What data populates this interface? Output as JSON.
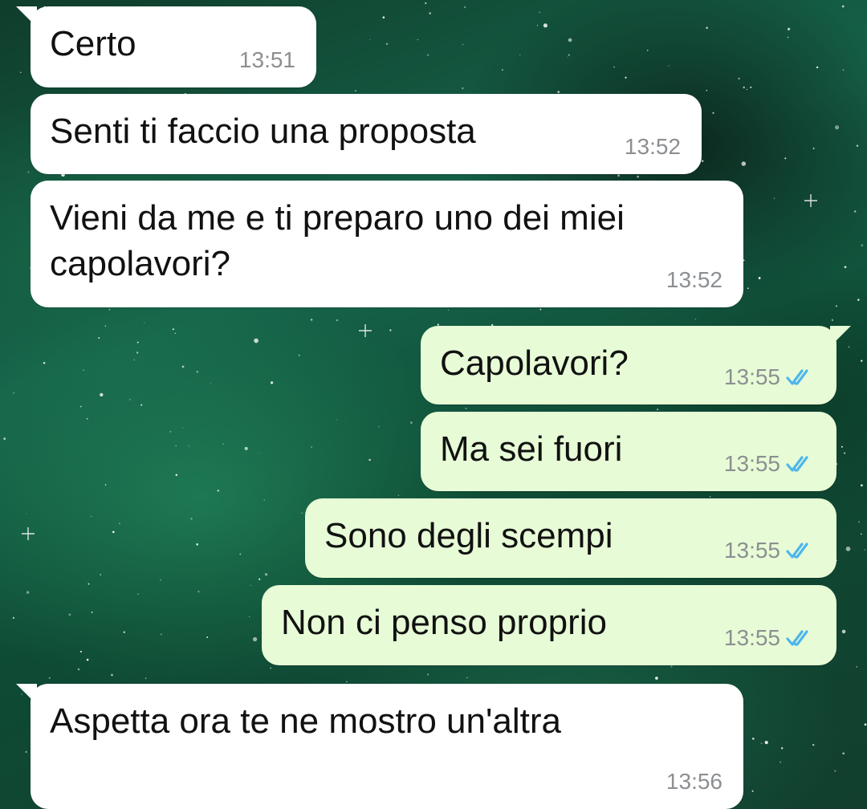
{
  "messages": [
    {
      "direction": "incoming",
      "text": "Certo",
      "time": "13:51"
    },
    {
      "direction": "incoming",
      "text": "Senti ti faccio una proposta",
      "time": "13:52"
    },
    {
      "direction": "incoming",
      "text": "Vieni da me e ti preparo uno dei miei\ncapolavori?",
      "time": "13:52"
    },
    {
      "direction": "outgoing",
      "text": "Capolavori?",
      "time": "13:55",
      "status": "read"
    },
    {
      "direction": "outgoing",
      "text": "Ma sei fuori",
      "time": "13:55",
      "status": "read"
    },
    {
      "direction": "outgoing",
      "text": "Sono degli scempi",
      "time": "13:55",
      "status": "read"
    },
    {
      "direction": "outgoing",
      "text": "Non ci penso proprio",
      "time": "13:55",
      "status": "read"
    },
    {
      "direction": "incoming",
      "text": "Aspetta ora te ne mostro un'altra",
      "time": "13:56"
    }
  ],
  "colors": {
    "incoming_bubble": "#ffffff",
    "outgoing_bubble": "#e7fcd6",
    "read_ticks": "#4fb6ec",
    "timestamp": "#8c8f92",
    "wallpaper": "#16644a"
  },
  "icons": {
    "read_receipt": "double-check-icon"
  }
}
